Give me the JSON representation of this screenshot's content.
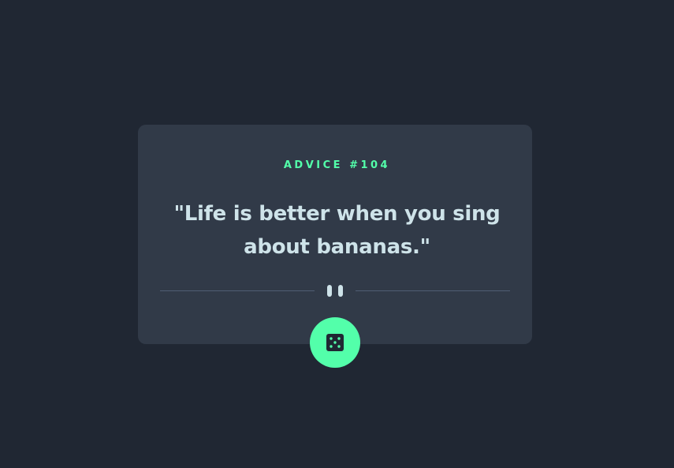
{
  "advice": {
    "id_label": "ADVICE #104",
    "quote": "\"Life is better when you sing about bananas.\""
  },
  "icons": {
    "divider": "pause-icon",
    "button": "dice-icon"
  },
  "colors": {
    "background": "#202733",
    "card": "#313a48",
    "accent": "#53ffaa",
    "text": "#cee3e9",
    "divider": "#4f5d74"
  }
}
